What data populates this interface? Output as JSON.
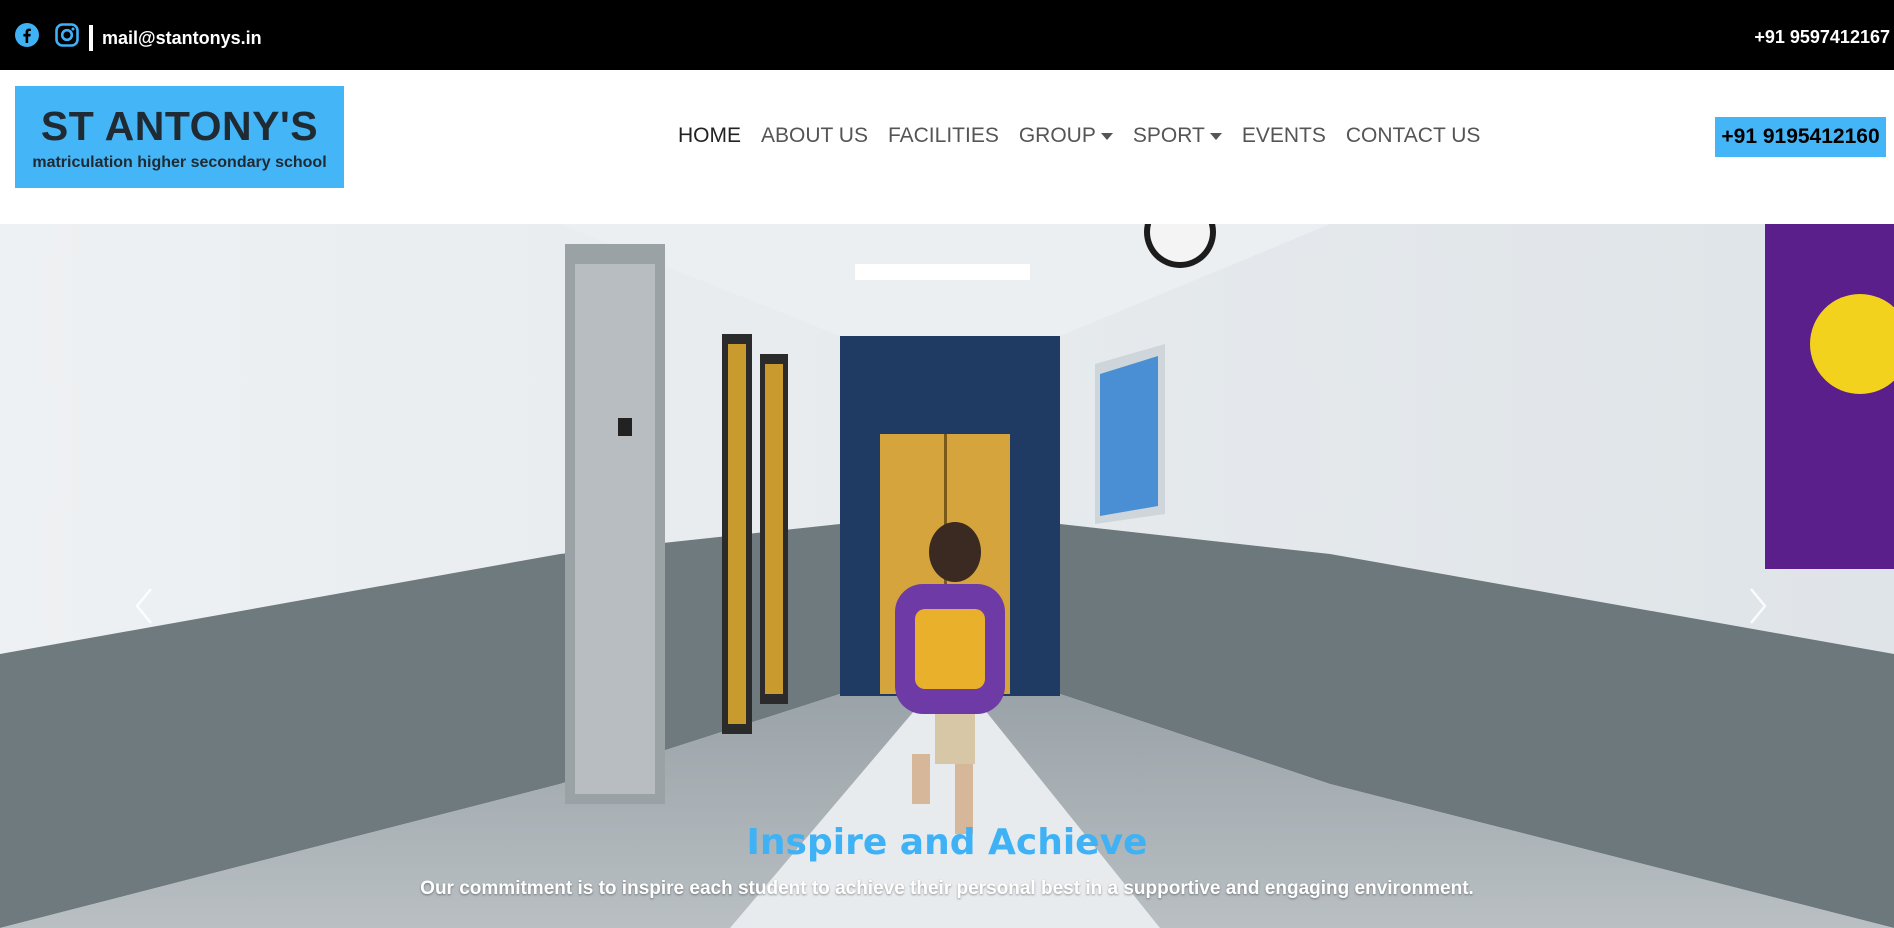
{
  "topbar": {
    "email": "mail@stantonys.in",
    "phone": "+91 9597412167",
    "social_icons": [
      "facebook-icon",
      "instagram-icon"
    ]
  },
  "logo": {
    "name": "ST ANTONY'S",
    "tagline": "matriculation higher secondary school"
  },
  "nav": {
    "items": [
      {
        "label": "HOME",
        "active": true
      },
      {
        "label": "ABOUT US"
      },
      {
        "label": "FACILITIES"
      },
      {
        "label": "GROUP",
        "dropdown": true
      },
      {
        "label": "SPORT",
        "dropdown": true
      },
      {
        "label": "EVENTS"
      },
      {
        "label": "CONTACT US"
      }
    ],
    "call_button": "+91 9195412160"
  },
  "hero": {
    "title": "Inspire and Achieve",
    "subtitle": "Our commitment is to inspire each student to achieve their personal best in a supportive and engaging environment.",
    "prev_icon": "chevron-left-icon",
    "next_icon": "chevron-right-icon"
  },
  "colors": {
    "accent": "#44b5f6",
    "topbar_bg": "#000000",
    "caption_title": "#3fb1f5"
  }
}
